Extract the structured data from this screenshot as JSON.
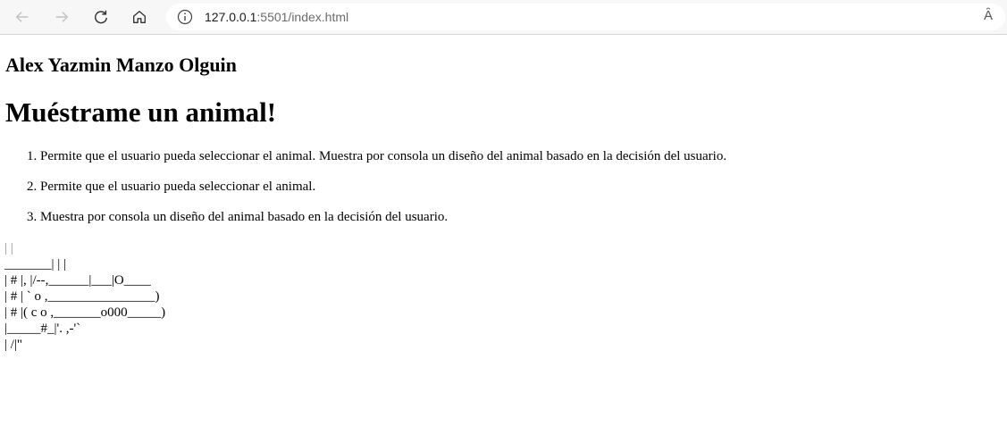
{
  "browser": {
    "url_host": "127.0.0.1",
    "url_rest": ":5501/index.html",
    "read_aloud_label": "Ȃ"
  },
  "page": {
    "author": "Alex Yazmin Manzo Olguin",
    "title": "Muéstrame un animal!",
    "tasks": [
      "Permite que el usuario pueda seleccionar el animal. Muestra por consola un diseño del animal basado en la decisión del usuario.",
      "Permite que el usuario pueda seleccionar el animal.",
      "Muestra por consola un diseño del animal basado en la decisión del usuario."
    ],
    "ascii_lines": [
      "| |",
      "_______| | |",
      "| # |, |/--,______|___|O____",
      "| # | ` o ,________________)",
      "| # |( c o ,_______o000_____)",
      "|_____#_|'. ,-'`",
      "| /|\""
    ]
  }
}
